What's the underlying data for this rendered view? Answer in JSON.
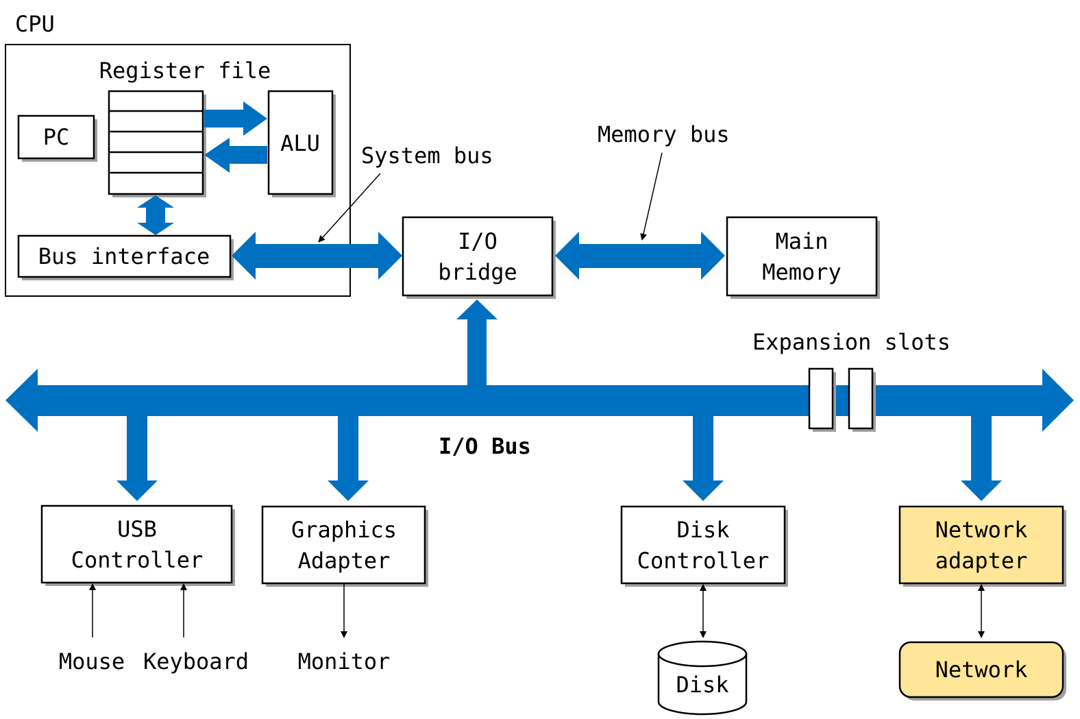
{
  "colors": {
    "bus": "#0070c0",
    "highlight": "#ffe699"
  },
  "cpu": {
    "label": "CPU",
    "register_file_label": "Register file",
    "pc_label": "PC",
    "alu_label": "ALU",
    "bus_interface_label": "Bus interface"
  },
  "buses": {
    "system_bus": "System bus",
    "memory_bus": "Memory bus",
    "io_bus": "I/O Bus",
    "expansion_slots": "Expansion slots"
  },
  "io_bridge": {
    "line1": "I/O",
    "line2": "bridge"
  },
  "main_memory": {
    "line1": "Main",
    "line2": "Memory"
  },
  "devices": {
    "usb": {
      "line1": "USB",
      "line2": "Controller"
    },
    "graphics": {
      "line1": "Graphics",
      "line2": "Adapter"
    },
    "disk_controller": {
      "line1": "Disk",
      "line2": "Controller"
    },
    "network_adapter": {
      "line1": "Network",
      "line2": "adapter"
    }
  },
  "peripherals": {
    "mouse": "Mouse",
    "keyboard": "Keyboard",
    "monitor": "Monitor",
    "disk": "Disk",
    "network": "Network"
  }
}
